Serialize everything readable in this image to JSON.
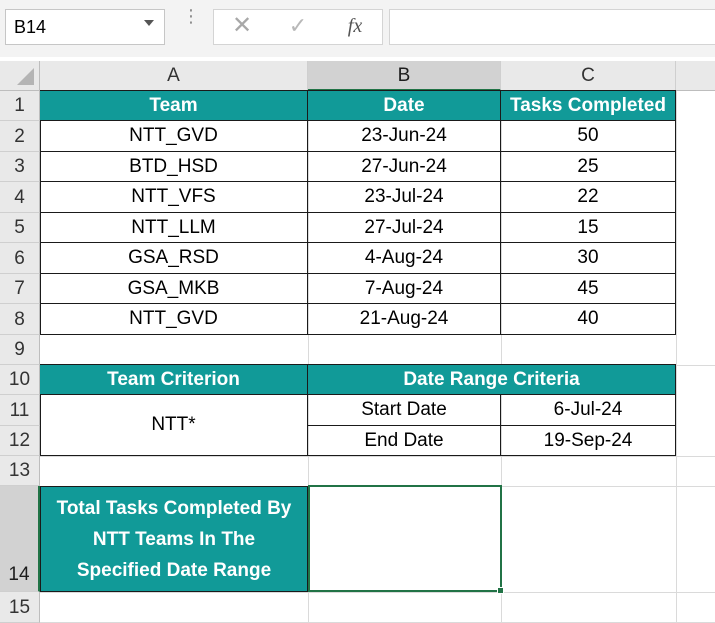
{
  "formula_bar": {
    "name_box": "B14",
    "cancel_icon": "close-icon",
    "enter_icon": "check-icon",
    "function_label": "fx",
    "formula": ""
  },
  "columns": [
    "A",
    "B",
    "C"
  ],
  "rows": [
    "1",
    "2",
    "3",
    "4",
    "5",
    "6",
    "7",
    "8",
    "9",
    "10",
    "11",
    "12",
    "13",
    "14",
    "15"
  ],
  "table": {
    "headers": [
      "Team",
      "Date",
      "Tasks Completed"
    ],
    "rows": [
      [
        "NTT_GVD",
        "23-Jun-24",
        "50"
      ],
      [
        "BTD_HSD",
        "27-Jun-24",
        "25"
      ],
      [
        "NTT_VFS",
        "23-Jul-24",
        "22"
      ],
      [
        "NTT_LLM",
        "27-Jul-24",
        "15"
      ],
      [
        "GSA_RSD",
        "4-Aug-24",
        "30"
      ],
      [
        "GSA_MKB",
        "7-Aug-24",
        "45"
      ],
      [
        "NTT_GVD",
        "21-Aug-24",
        "40"
      ]
    ]
  },
  "criteria": {
    "team_header": "Team Criterion",
    "date_header": "Date Range Criteria",
    "team_value": "NTT*",
    "start_label": "Start Date",
    "start_value": "6-Jul-24",
    "end_label": "End Date",
    "end_value": "19-Sep-24"
  },
  "result": {
    "label": "Total Tasks Completed By NTT Teams In The Specified Date Range",
    "value": ""
  },
  "colors": {
    "header_fill": "#119a98",
    "selection": "#217346"
  }
}
